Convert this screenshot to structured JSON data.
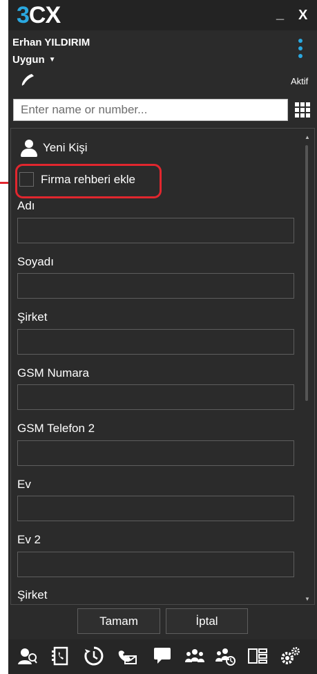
{
  "app": {
    "logo_prefix": "3",
    "logo_suffix": "CX",
    "minimize_label": "_",
    "close_label": "X"
  },
  "user": {
    "name": "Erhan YILDIRIM",
    "status": "Uygun",
    "presence": "Aktif"
  },
  "search": {
    "placeholder": "Enter name or number..."
  },
  "form": {
    "title": "Yeni Kişi",
    "checkbox_label": "Firma rehberi ekle",
    "checkbox_checked": false,
    "fields": [
      {
        "label": "Adı",
        "value": ""
      },
      {
        "label": "Soyadı",
        "value": ""
      },
      {
        "label": "Şirket",
        "value": ""
      },
      {
        "label": "GSM Numara",
        "value": ""
      },
      {
        "label": "GSM Telefon 2",
        "value": ""
      },
      {
        "label": "Ev",
        "value": ""
      },
      {
        "label": "Ev 2",
        "value": ""
      },
      {
        "label": "Şirket",
        "value": ""
      }
    ]
  },
  "buttons": {
    "ok": "Tamam",
    "cancel": "İptal"
  },
  "toolbar": {
    "icons": [
      "contacts-icon",
      "phonebook-icon",
      "history-icon",
      "voicemail-icon",
      "chat-icon",
      "presence-icon",
      "conference-icon",
      "layout-icon",
      "settings-icon"
    ]
  },
  "colors": {
    "accent": "#2aa8e0",
    "background": "#2b2b2b",
    "highlight": "#e1262e"
  }
}
